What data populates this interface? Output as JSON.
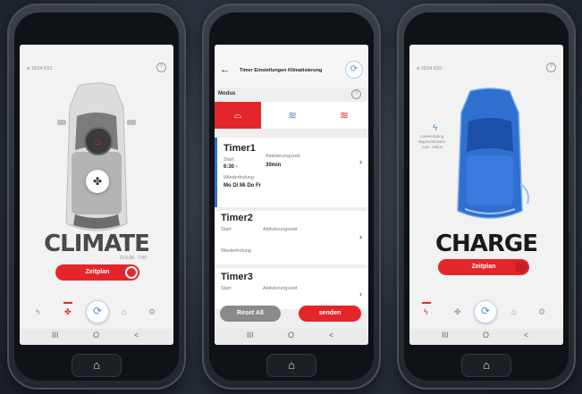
{
  "phone1": {
    "status": "⧖ 10/14 9:51",
    "info": "?",
    "title": "CLIMATE",
    "subtitle": "Di 6:30 - 7:00",
    "schedule_button": "Zeitplan",
    "nav_icons": [
      "bolt-icon",
      "fan-icon",
      "sync-icon",
      "car-icon",
      "gear-icon"
    ],
    "sys_nav": [
      "III",
      "O",
      "<"
    ],
    "home": "⌂"
  },
  "phone2": {
    "back": "←",
    "header_title": "Timer Einstellungen Klimatisierung",
    "mode_label": "Modus",
    "info": "?",
    "timers": [
      {
        "title": "Timer1",
        "start_label": "Start",
        "start_value": "6:30 -",
        "activation_label": "Aktivierungszeit",
        "activation_value": "30min",
        "repeat_label": "Wiederholung",
        "repeat_value": "Mo Di Mi Do Fr"
      },
      {
        "title": "Timer2",
        "start_label": "Start",
        "activation_label": "Aktivierungszeit",
        "repeat_label": "Wiederholung"
      },
      {
        "title": "Timer3",
        "start_label": "Start",
        "activation_label": "Aktivierungszeit"
      }
    ],
    "reset_button": "Reset All",
    "send_button": "senden",
    "sys_nav": [
      "III",
      "O",
      "<"
    ],
    "home": "⌂"
  },
  "phone3": {
    "status": "⧖ 10/14 9:51",
    "info": "?",
    "charge_note_1": "Ladevorgang",
    "charge_note_2": "abgeschlossen",
    "charge_note_3": "max. Akkus",
    "title": "CHARGE",
    "schedule_button": "Zeitplan",
    "sys_nav": [
      "III",
      "O",
      "<"
    ],
    "home": "⌂"
  },
  "colors": {
    "accent_red": "#e4262b",
    "blue": "#2f6fd0"
  }
}
